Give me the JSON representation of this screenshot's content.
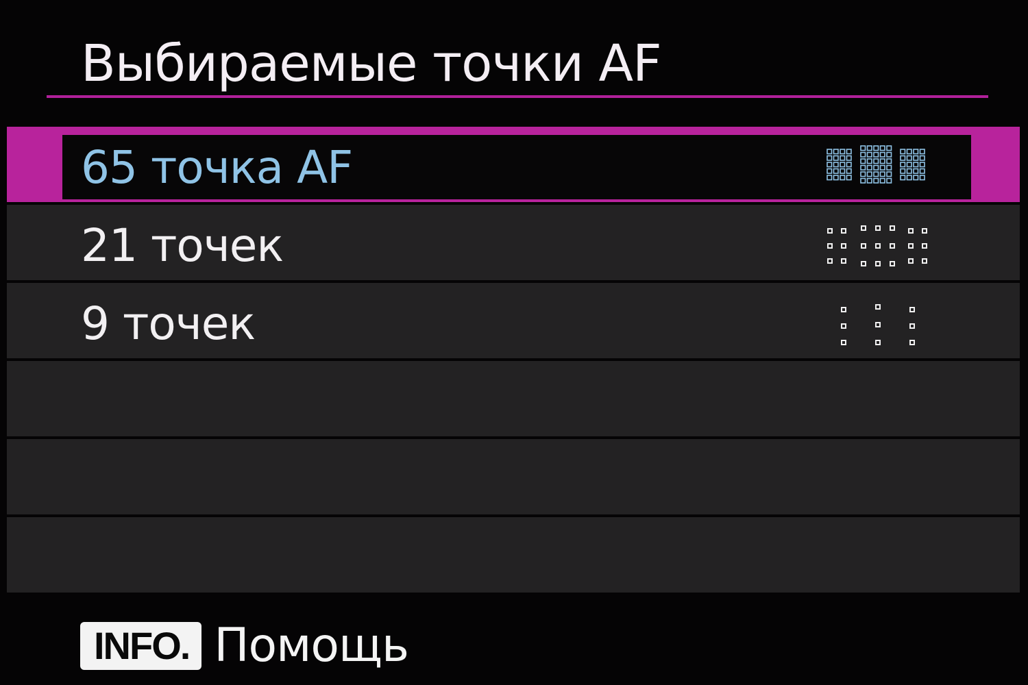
{
  "header": {
    "title": "Выбираемые точки AF"
  },
  "menu": {
    "items": [
      {
        "label": "65 точка AF",
        "icon": "af-65-point-grid-icon",
        "selected": true
      },
      {
        "label": "21 точек",
        "icon": "af-21-point-grid-icon",
        "selected": false
      },
      {
        "label": "9 точек",
        "icon": "af-9-point-grid-icon",
        "selected": false
      },
      {
        "label": "",
        "selected": false
      },
      {
        "label": "",
        "selected": false
      },
      {
        "label": "",
        "selected": false
      }
    ]
  },
  "footer": {
    "info_button": "INFO.",
    "help_label": "Помощь"
  },
  "colors": {
    "accent": "#b8239c",
    "selected_text": "#8fc3e6",
    "row_background": "#232223",
    "background": "#050405"
  }
}
